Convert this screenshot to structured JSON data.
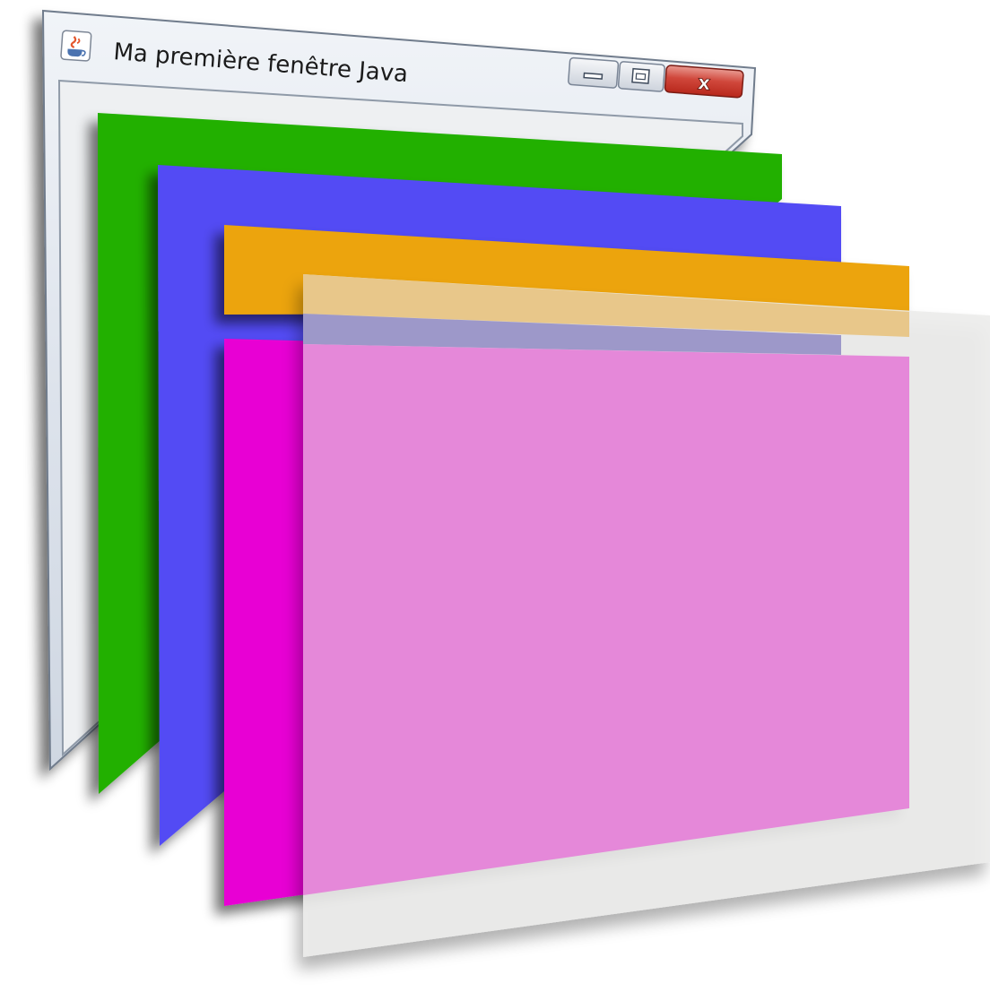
{
  "window": {
    "title": "Ma première fenêtre Java",
    "app_icon": "java-cup-icon",
    "buttons": {
      "minimize_icon": "minimize-icon",
      "maximize_icon": "maximize-icon",
      "close_icon": "close-icon",
      "close_glyph": "x"
    }
  },
  "layers": [
    {
      "name": "green-layer",
      "color": "#21b006"
    },
    {
      "name": "blue-layer",
      "color": "#534bf4"
    },
    {
      "name": "orange-layer",
      "color": "#eca409"
    },
    {
      "name": "magenta-layer",
      "color": "#e800d4"
    },
    {
      "name": "glass-pane",
      "color": "#ececea"
    }
  ],
  "colors": {
    "pink_overlay": "#e588d9",
    "beige_overlay": "#e8c78a",
    "close_button": "#d0473b",
    "frame_chrome": "#dfe4ec"
  }
}
